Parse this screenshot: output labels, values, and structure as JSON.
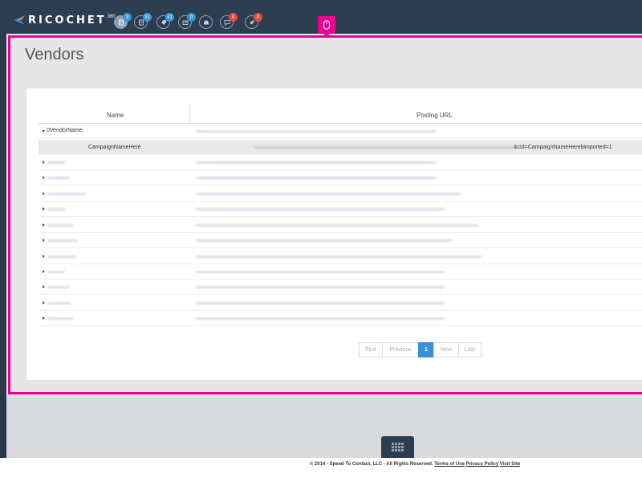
{
  "app": {
    "logo_text": "RICOCHET",
    "logo_sup": "360"
  },
  "nav": [
    {
      "icon": "document-icon",
      "badge": "3",
      "badge_color": "#3498db"
    },
    {
      "icon": "report-icon",
      "badge": "31",
      "badge_color": "#3498db"
    },
    {
      "icon": "tag-icon",
      "badge": "41",
      "badge_color": "#3498db"
    },
    {
      "icon": "envelope-icon",
      "badge": "0",
      "badge_color": "#3498db"
    },
    {
      "icon": "inbox-icon",
      "badge": "",
      "badge_color": ""
    },
    {
      "icon": "chat-icon",
      "badge": "0",
      "badge_color": "#e74c3c"
    },
    {
      "icon": "rocket-icon",
      "badge": "0",
      "badge_color": "#e74c3c"
    }
  ],
  "page": {
    "title": "Vendors"
  },
  "table": {
    "columns": [
      "Name",
      "Posting URL"
    ],
    "expanded_vendor": "0VendorName",
    "campaign": {
      "name": "CampaignNameHere",
      "url_suffix": "&cid=CampaignNameHerebimported=1"
    }
  },
  "pagination": [
    "First",
    "Previous",
    "1",
    "Next",
    "Last"
  ],
  "footer": {
    "copyright": "© 2014 - Speed To Contact, LLC - All Rights Reserved.",
    "terms": "Terms of Use",
    "privacy": "Privacy Policy",
    "visit": "Visit Site"
  },
  "colors": {
    "accent": "#ec008c",
    "header": "#2c3e50",
    "primary": "#3a8fd6"
  }
}
